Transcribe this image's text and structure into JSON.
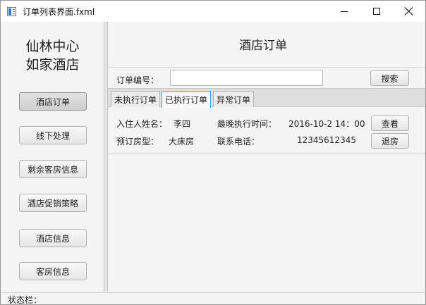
{
  "window": {
    "title": "订单列表界面.fxml"
  },
  "sidebar": {
    "hotel_name_line1": "仙林中心",
    "hotel_name_line2": "如家酒店",
    "items": [
      {
        "label": "酒店订单",
        "active": true
      },
      {
        "label": "线下处理",
        "active": false
      },
      {
        "label": "剩余客房信息",
        "active": false
      },
      {
        "label": "酒店促销策略",
        "active": false
      },
      {
        "label": "酒店信息",
        "active": false
      },
      {
        "label": "客房信息",
        "active": false
      }
    ]
  },
  "main": {
    "title": "酒店订单",
    "search": {
      "label": "订单编号：",
      "value": "",
      "button_label": "搜索"
    },
    "tabs": [
      {
        "label": "未执行订单",
        "selected": false
      },
      {
        "label": "已执行订单",
        "selected": true
      },
      {
        "label": "异常订单",
        "selected": false
      }
    ],
    "order": {
      "guest_name_label": "入住人姓名：",
      "guest_name": "李四",
      "latest_time_label": "最晚执行时间：",
      "latest_time": "2016-10-2 14：00",
      "view_button": "查看",
      "room_type_label": "预订房型：",
      "room_type": "大床房",
      "phone_label": "联系电话：",
      "phone": "12345612345",
      "checkout_button": "退房"
    }
  },
  "statusbar": {
    "label": "状态栏："
  },
  "colors": {
    "tab_selected_border": "#5a9bd5",
    "background": "#f4f4f4"
  }
}
